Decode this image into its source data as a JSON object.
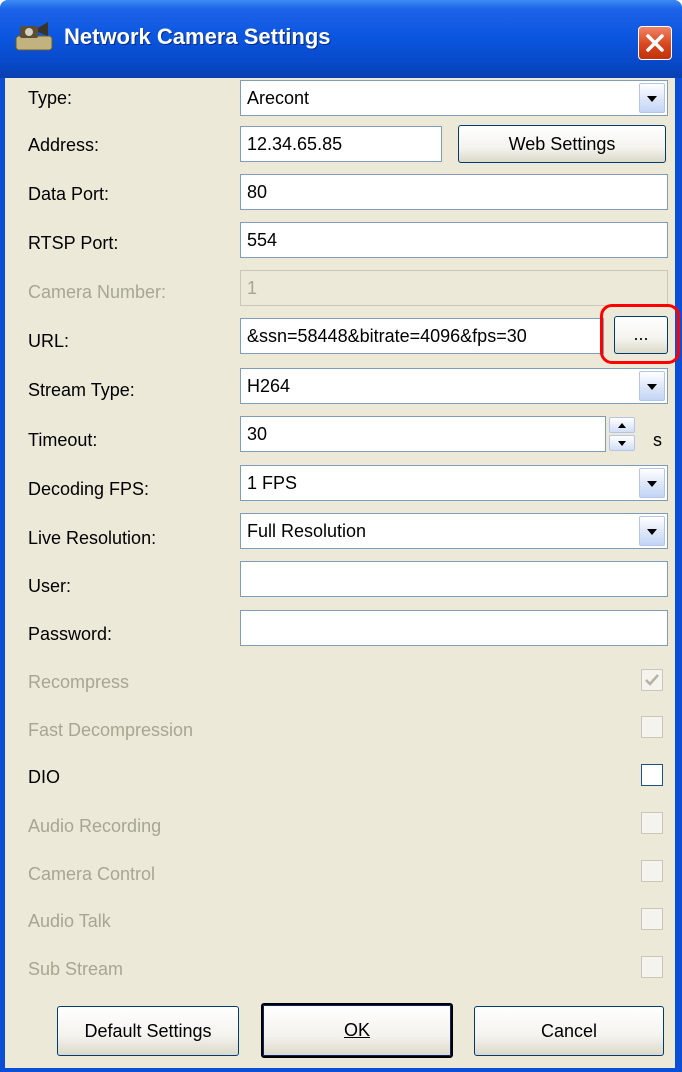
{
  "window": {
    "title": "Network Camera Settings",
    "title_icon": "camera-app-icon",
    "close_icon": "close-icon"
  },
  "form": {
    "type": {
      "label": "Type:",
      "value": "Arecont"
    },
    "address": {
      "label": "Address:",
      "value": "12.34.65.85",
      "web_settings_label": "Web Settings"
    },
    "data_port": {
      "label": "Data Port:",
      "value": "80"
    },
    "rtsp_port": {
      "label": "RTSP Port:",
      "value": "554"
    },
    "camera_number": {
      "label": "Camera Number:",
      "value": "1"
    },
    "url": {
      "label": "URL:",
      "value": "&ssn=58448&bitrate=4096&fps=30",
      "browse_label": "..."
    },
    "stream_type": {
      "label": "Stream Type:",
      "value": "H264"
    },
    "timeout": {
      "label": "Timeout:",
      "value": "30",
      "unit": "s"
    },
    "decoding_fps": {
      "label": "Decoding FPS:",
      "value": "1 FPS"
    },
    "live_resolution": {
      "label": "Live Resolution:",
      "value": "Full Resolution"
    },
    "user": {
      "label": "User:",
      "value": ""
    },
    "password": {
      "label": "Password:",
      "value": ""
    }
  },
  "options": [
    {
      "label": "Recompress",
      "checked": true,
      "enabled": false
    },
    {
      "label": "Fast Decompression",
      "checked": false,
      "enabled": false
    },
    {
      "label": "DIO",
      "checked": false,
      "enabled": true
    },
    {
      "label": "Audio Recording",
      "checked": false,
      "enabled": false
    },
    {
      "label": "Camera Control",
      "checked": false,
      "enabled": false
    },
    {
      "label": "Audio Talk",
      "checked": false,
      "enabled": false
    },
    {
      "label": "Sub Stream",
      "checked": false,
      "enabled": false
    }
  ],
  "buttons": {
    "default_settings": "Default Settings",
    "ok": "OK",
    "cancel": "Cancel"
  },
  "colors": {
    "title_bar": "#0a55df",
    "dialog_bg": "#ece9d8",
    "highlight": "#ff0000",
    "disabled_text": "#a7a692"
  }
}
